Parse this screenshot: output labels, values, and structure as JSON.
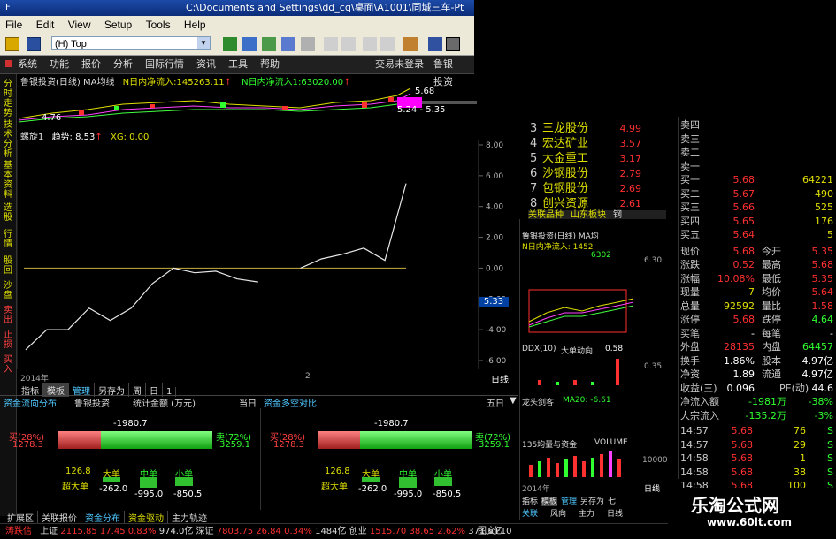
{
  "titlebar": {
    "text": "C:\\Documents and Settings\\dd_cq\\桌面\\A1001\\同城三车-Pt"
  },
  "menubar": {
    "items": [
      "File",
      "Edit",
      "View",
      "Setup",
      "Tools",
      "Help"
    ]
  },
  "toolbar": {
    "combo_value": "(H) Top"
  },
  "appmenu": {
    "items": [
      "系统",
      "功能",
      "报价",
      "分析",
      "国际行情",
      "资讯",
      "工具",
      "帮助"
    ],
    "login": "交易未登录",
    "broker": "鲁银投资"
  },
  "vtabs": [
    "分时走势",
    "技术分析",
    "基本资料",
    "选股",
    "行情",
    "股回",
    "沙盘",
    "卖出",
    "止损",
    "买入"
  ],
  "chart": {
    "header": "鲁银投资(日线) MA均线",
    "net_label1": "N日内净流入:",
    "net_value1": "145263.11",
    "net_label2": "N日内净流入1:",
    "net_value2": "63020.00",
    "price_high": "5.68",
    "price_low": "4.76",
    "price_range": "5.24 - 5.35",
    "ind_header": "螺旋1",
    "ind_trend_label": "趋势:",
    "ind_trend_value": "8.53",
    "ind_xg": "XG: 0.00",
    "yticks": [
      "8.00",
      "6.00",
      "4.00",
      "2.00",
      "0.00",
      "-2.00",
      "-4.00",
      "-6.00"
    ],
    "price_marker": "5.33",
    "xdate": "2014年",
    "xtick": "2",
    "period": "日线"
  },
  "chart_data": {
    "type": "line",
    "series": [
      {
        "values": [
          -5.3,
          -4.0,
          -4.0,
          -2.6,
          -3.4,
          -2.6,
          -1.0,
          0.0,
          -0.3,
          -0.2,
          -0.7,
          -0.9,
          null,
          0.0,
          0.6,
          0.9,
          1.3,
          0.5,
          5.5
        ]
      }
    ],
    "ylim": [
      -6,
      8
    ]
  },
  "bottomtabs": [
    "指标",
    "模板",
    "管理",
    "另存为",
    "周",
    "日",
    "1"
  ],
  "fundpanel": {
    "title": "资金流向分布",
    "stock": "鲁银投资",
    "stat": "统计金额 (万元)",
    "day": "当日",
    "title2": "资金多空对比",
    "range": "五日",
    "net": "-1980.7",
    "buy_label": "买(28%)",
    "buy_value": "1278.3",
    "sell_label": "卖(72%)",
    "sell_value": "3259.1",
    "vals": [
      "126.8",
      "-262.0",
      "-995.0",
      "-850.5"
    ],
    "cats": [
      "超大单",
      "大单",
      "中单",
      "小单"
    ]
  },
  "footertabs": [
    "扩展区",
    "关联报价",
    "资金分布",
    "资金驱动",
    "主力轨迹"
  ],
  "statusbar": {
    "ticker": "涛跌信",
    "sh_label": "上证",
    "sh_val": "2115.85",
    "sh_chg": "17.45",
    "sh_pct": "0.83%",
    "sh_amt": "974.0亿",
    "sz_label": "深证",
    "sz_val": "7803.75",
    "sz_chg": "26.84",
    "sz_pct": "0.34%",
    "sz_amt": "1484亿",
    "cy_label": "创业",
    "cy_val": "1515.70",
    "cy_chg": "38.65",
    "cy_pct": "2.62%",
    "cy_amt": "371.6亿",
    "f10": "图文F10"
  },
  "stocklist": [
    {
      "n": "3",
      "name": "三龙股份",
      "v": "4.99"
    },
    {
      "n": "4",
      "name": "宏达矿业",
      "v": "3.57"
    },
    {
      "n": "5",
      "name": "大金重工",
      "v": "3.17"
    },
    {
      "n": "6",
      "name": "沙钢股份",
      "v": "2.79"
    },
    {
      "n": "7",
      "name": "包钢股份",
      "v": "2.69"
    },
    {
      "n": "8",
      "name": "创兴资源",
      "v": "2.61"
    }
  ],
  "stocktabs": [
    "关联品种",
    "山东板块",
    "钢"
  ],
  "quote": {
    "sells": [
      {
        "k": "卖四",
        "p": "",
        "v": ""
      },
      {
        "k": "卖三",
        "p": "",
        "v": ""
      },
      {
        "k": "卖二",
        "p": "",
        "v": ""
      },
      {
        "k": "卖一",
        "p": "",
        "v": ""
      }
    ],
    "buys": [
      {
        "k": "买一",
        "p": "5.68",
        "v": "64221"
      },
      {
        "k": "买二",
        "p": "5.67",
        "v": "490"
      },
      {
        "k": "买三",
        "p": "5.66",
        "v": "525"
      },
      {
        "k": "买四",
        "p": "5.65",
        "v": "176"
      },
      {
        "k": "买五",
        "p": "5.64",
        "v": "5"
      }
    ],
    "stats": [
      {
        "k": "现价",
        "v1": "5.68",
        "c1": "red",
        "k2": "今开",
        "v2": "5.35",
        "c2": "red"
      },
      {
        "k": "涨跌",
        "v1": "0.52",
        "c1": "red",
        "k2": "最高",
        "v2": "5.68",
        "c2": "red"
      },
      {
        "k": "涨幅",
        "v1": "10.08%",
        "c1": "red",
        "k2": "最低",
        "v2": "5.35",
        "c2": "red"
      },
      {
        "k": "现量",
        "v1": "7",
        "c1": "yel",
        "k2": "均价",
        "v2": "5.64",
        "c2": "red"
      },
      {
        "k": "总量",
        "v1": "92592",
        "c1": "yel",
        "k2": "量比",
        "v2": "1.58",
        "c2": "red"
      },
      {
        "k": "涨停",
        "v1": "5.68",
        "c1": "red",
        "k2": "跌停",
        "v2": "4.64",
        "c2": "grn"
      },
      {
        "k": "买笔",
        "v1": "-",
        "c1": "wht",
        "k2": "每笔",
        "v2": "-",
        "c2": "wht"
      },
      {
        "k": "外盘",
        "v1": "28135",
        "c1": "red",
        "k2": "内盘",
        "v2": "64457",
        "c2": "grn"
      },
      {
        "k": "换手",
        "v1": "1.86%",
        "c1": "wht",
        "k2": "股本",
        "v2": "4.97亿",
        "c2": "wht"
      },
      {
        "k": "净资",
        "v1": "1.89",
        "c1": "wht",
        "k2": "流通",
        "v2": "4.97亿",
        "c2": "wht"
      },
      {
        "k": "收益(三)",
        "v1": "0.096",
        "c1": "wht",
        "k2": "PE(动)",
        "v2": "44.6",
        "c2": "wht"
      }
    ],
    "netflow": {
      "k": "净流入额",
      "v1": "-1981万",
      "v2": "-38%"
    },
    "bigflow": {
      "k": "大宗流入",
      "v1": "-135.2万",
      "v2": "-3%"
    },
    "ticks": [
      {
        "t": "14:57",
        "p": "5.68",
        "v": "76",
        "s": "S"
      },
      {
        "t": "14:57",
        "p": "5.68",
        "v": "29",
        "s": "S"
      },
      {
        "t": "14:58",
        "p": "5.68",
        "v": "1",
        "s": "S"
      },
      {
        "t": "14:58",
        "p": "5.68",
        "v": "38",
        "s": "S"
      },
      {
        "t": "14:58",
        "p": "5.68",
        "v": "100",
        "s": "S"
      }
    ]
  },
  "mini": {
    "header": "鲁银投资(日线) MA均",
    "net": "N日内净流入: 1452",
    "v1": "6302",
    "ddx": "DDX(10)",
    "ddx_label": "大单动向:",
    "ddx_val": "0.58",
    "ma": "MA20: -6.61",
    "tab1": "龙头剑客",
    "vol": "135均量与资金",
    "vol2": "VOLUME",
    "price1": "6.30",
    "price2": "0.35",
    "vol_tick": "10000",
    "date": "2014年",
    "period": "日线",
    "tabs": [
      "指标",
      "模板",
      "管理",
      "另存为",
      "七"
    ],
    "tabs2": [
      "关联",
      "风向",
      "主力",
      "日线"
    ]
  },
  "watermark": {
    "title": "乐淘公式网",
    "url": "www.60lt.com"
  }
}
